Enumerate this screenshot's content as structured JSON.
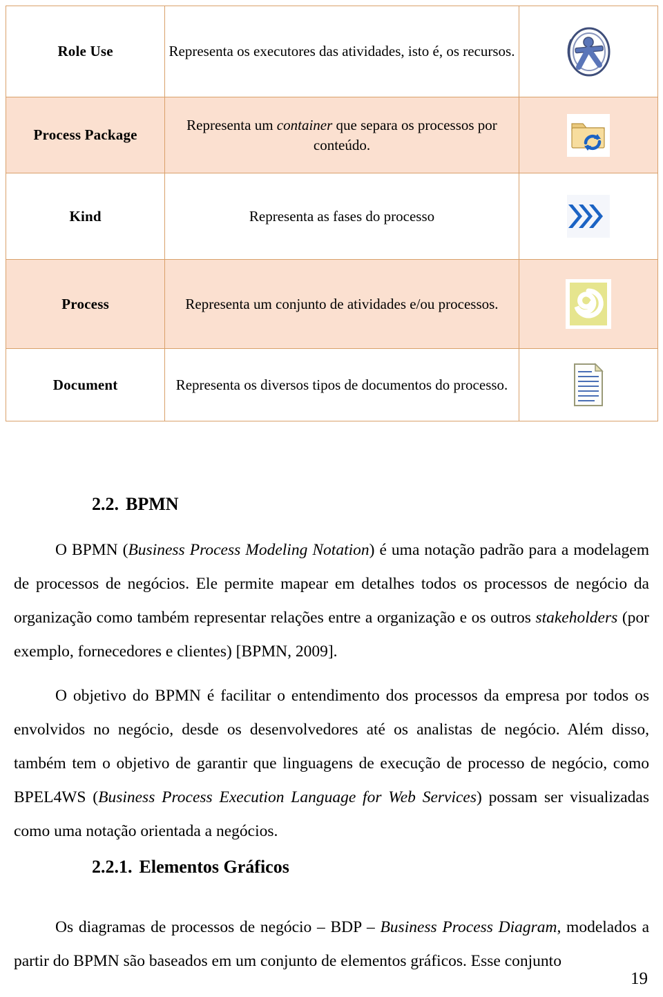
{
  "table": {
    "rows": [
      {
        "name": "Role Use",
        "description_parts": [
          {
            "text": "Representa os executores das atividades, isto é, os recursos.",
            "italic": false
          }
        ],
        "icon": "role-use-icon",
        "shading": "white"
      },
      {
        "name": "Process Package",
        "description_parts": [
          {
            "text": "Representa um ",
            "italic": false
          },
          {
            "text": "container",
            "italic": true
          },
          {
            "text": " que separa os processos por conteúdo.",
            "italic": false
          }
        ],
        "icon": "process-package-folder-icon",
        "shading": "peach"
      },
      {
        "name": "Kind",
        "description_parts": [
          {
            "text": "Representa as fases do processo",
            "italic": false
          }
        ],
        "icon": "kind-chevrons-icon",
        "shading": "white"
      },
      {
        "name": "Process",
        "description_parts": [
          {
            "text": "Representa um conjunto de atividades e/ou processos.",
            "italic": false
          }
        ],
        "icon": "process-spiral-icon",
        "shading": "peach"
      },
      {
        "name": "Document",
        "description_parts": [
          {
            "text": "Representa os diversos tipos de documentos do processo.",
            "italic": false
          }
        ],
        "icon": "document-page-icon",
        "shading": "white"
      }
    ]
  },
  "sections": [
    {
      "number": "2.2.",
      "title": "BPMN"
    },
    {
      "number": "2.2.1.",
      "title": "Elementos Gráficos"
    }
  ],
  "paragraphs": [
    {
      "id": "p1",
      "parts": [
        {
          "text": "O BPMN (",
          "italic": false
        },
        {
          "text": "Business Process Modeling Notation",
          "italic": true
        },
        {
          "text": ") é uma notação padrão para a modelagem de processos de negócios. Ele permite mapear em detalhes todos os processos de negócio da organização como também representar relações entre a organização e os outros ",
          "italic": false
        },
        {
          "text": "stakeholders",
          "italic": true
        },
        {
          "text": " (por exemplo, fornecedores e clientes) [BPMN, 2009].",
          "italic": false
        }
      ]
    },
    {
      "id": "p2",
      "parts": [
        {
          "text": "O objetivo do BPMN é facilitar o entendimento dos processos da empresa por todos os envolvidos no negócio, desde os desenvolvedores até os analistas de negócio. Além disso, também tem o objetivo de garantir que linguagens de execução de processo de negócio, como BPEL4WS (",
          "italic": false
        },
        {
          "text": "Business Process Execution Language for Web Services",
          "italic": true
        },
        {
          "text": ") possam ser visualizadas como uma notação orientada a negócios.",
          "italic": false
        }
      ]
    },
    {
      "id": "p3",
      "parts": [
        {
          "text": "Os diagramas de processos de negócio – BDP – ",
          "italic": false
        },
        {
          "text": "Business Process Diagram",
          "italic": true
        },
        {
          "text": ", modelados a partir do BPMN são baseados em um conjunto de elementos gráficos. Esse conjunto",
          "italic": false
        }
      ]
    }
  ],
  "page_number": "19",
  "colors": {
    "table_border": "#d9a06a",
    "row_shade": "#fbe0d0",
    "icon_blue": "#3a5fa8",
    "icon_folder": "#f3d79a",
    "icon_yellow": "#e3e08a",
    "text": "#000000"
  }
}
